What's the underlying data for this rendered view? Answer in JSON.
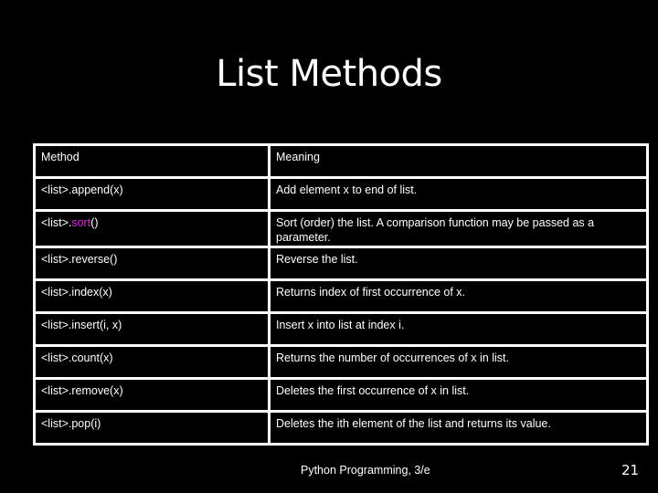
{
  "slide": {
    "title": "List Methods",
    "footer": "Python Programming, 3/e",
    "page_number": "21",
    "highlight_color": "#cc33cc"
  },
  "table": {
    "headers": [
      "Method",
      "Meaning"
    ],
    "rows": [
      {
        "method_prefix": "<list>.",
        "method_name": "append",
        "method_args": "(x)",
        "highlight": false,
        "meaning": "Add element x to end of list."
      },
      {
        "method_prefix": "<list>.",
        "method_name": "sort",
        "method_args": "()",
        "highlight": true,
        "meaning": "Sort (order) the list. A comparison function may be passed as a parameter."
      },
      {
        "method_prefix": "<list>.",
        "method_name": "reverse",
        "method_args": "()",
        "highlight": false,
        "meaning": "Reverse the list."
      },
      {
        "method_prefix": "<list>.",
        "method_name": "index",
        "method_args": "(x)",
        "highlight": false,
        "meaning": "Returns index of first occurrence of x."
      },
      {
        "method_prefix": "<list>.",
        "method_name": "insert",
        "method_args": "(i, x)",
        "highlight": false,
        "meaning": "Insert x into list at index i."
      },
      {
        "method_prefix": "<list>.",
        "method_name": "count",
        "method_args": "(x)",
        "highlight": false,
        "meaning": "Returns the number of occurrences of x in list."
      },
      {
        "method_prefix": "<list>.",
        "method_name": "remove",
        "method_args": "(x)",
        "highlight": false,
        "meaning": "Deletes the first occurrence of x in list."
      },
      {
        "method_prefix": "<list>.",
        "method_name": "pop",
        "method_args": "(i)",
        "highlight": false,
        "meaning": "Deletes the ith element of the list and returns its value."
      }
    ]
  }
}
